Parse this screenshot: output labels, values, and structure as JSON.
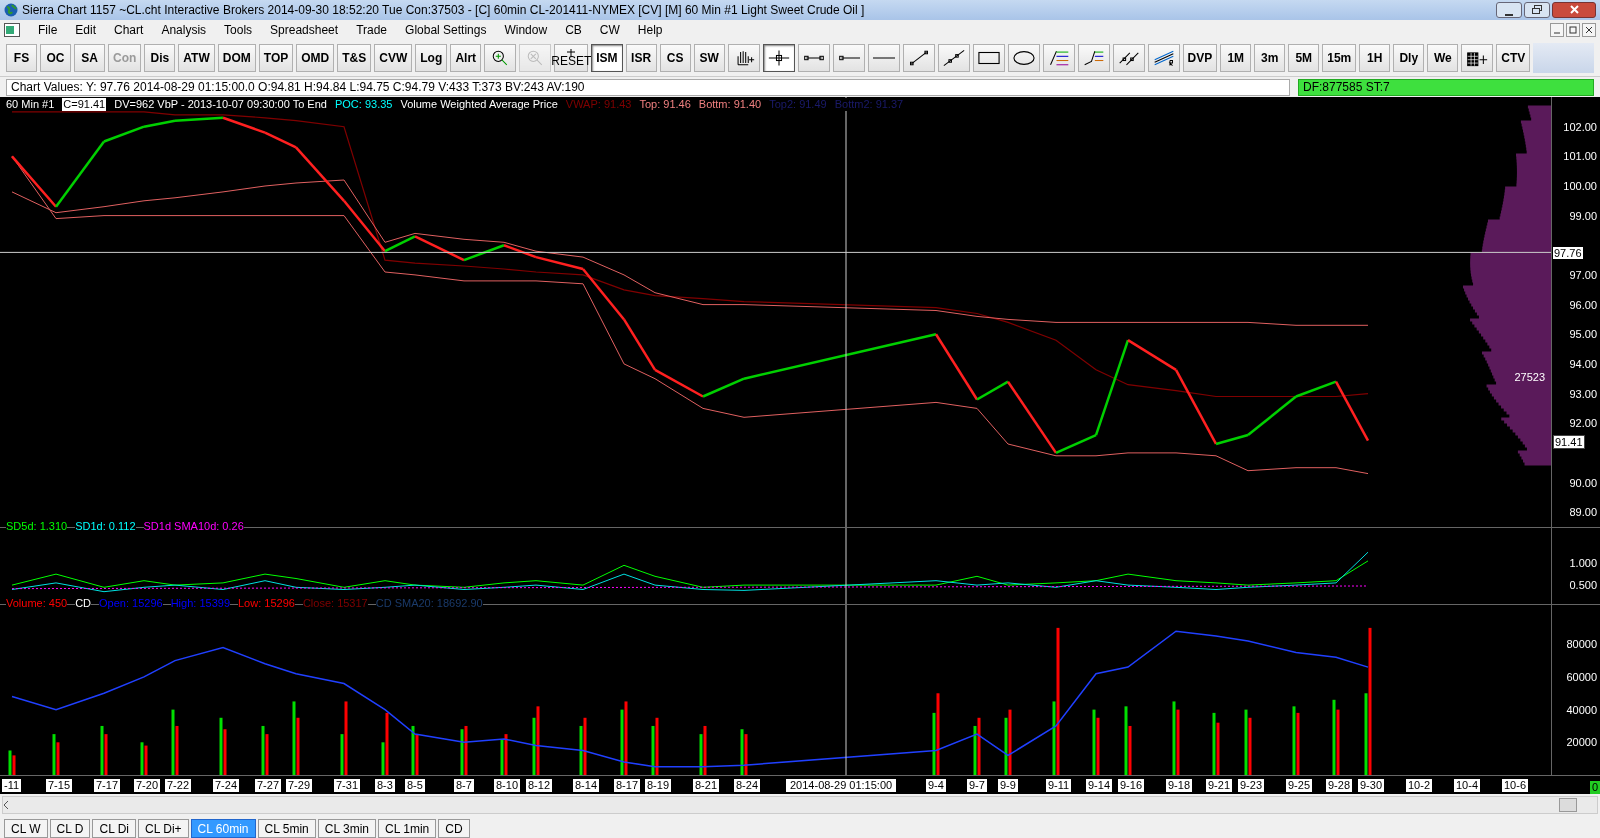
{
  "window": {
    "title": "Sierra Chart 1157 ~CL.cht  Interactive Brokers 2014-09-30  18:52:20 Tue  Con:37503 - [C] 60min  CL-201411-NYMEX [CV] [M]  60 Min  #1  Light Sweet Crude Oil ]"
  },
  "menu": [
    "File",
    "Edit",
    "Chart",
    "Analysis",
    "Tools",
    "Spreadsheet",
    "Trade",
    "Global Settings",
    "Window",
    "CB",
    "CW",
    "Help"
  ],
  "toolbar": [
    {
      "kind": "text",
      "label": "FS",
      "disabled": false,
      "selected": false
    },
    {
      "kind": "text",
      "label": "OC",
      "disabled": false,
      "selected": false
    },
    {
      "kind": "text",
      "label": "SA",
      "disabled": false,
      "selected": false
    },
    {
      "kind": "text",
      "label": "Con",
      "disabled": true,
      "selected": false
    },
    {
      "kind": "text",
      "label": "Dis",
      "disabled": false,
      "selected": false
    },
    {
      "kind": "text",
      "label": "ATW",
      "disabled": false,
      "selected": false
    },
    {
      "kind": "text",
      "label": "DOM",
      "disabled": false,
      "selected": false
    },
    {
      "kind": "text",
      "label": "TOP",
      "disabled": false,
      "selected": false
    },
    {
      "kind": "text",
      "label": "OMD",
      "disabled": false,
      "selected": false
    },
    {
      "kind": "text",
      "label": "T&S",
      "disabled": false,
      "selected": false
    },
    {
      "kind": "text",
      "label": "CVW",
      "disabled": false,
      "selected": false
    },
    {
      "kind": "text",
      "label": "Log",
      "disabled": false,
      "selected": false
    },
    {
      "kind": "text",
      "label": "Alrt",
      "disabled": false,
      "selected": false
    },
    {
      "kind": "zoom",
      "disabled": false,
      "selected": false
    },
    {
      "kind": "zoomx",
      "disabled": true,
      "selected": false
    },
    {
      "kind": "reset",
      "label": "RESET",
      "disabled": false,
      "selected": false
    },
    {
      "kind": "text",
      "label": "ISM",
      "disabled": false,
      "selected": true
    },
    {
      "kind": "text",
      "label": "ISR",
      "disabled": false,
      "selected": false
    },
    {
      "kind": "text",
      "label": "CS",
      "disabled": false,
      "selected": false
    },
    {
      "kind": "text",
      "label": "SW",
      "disabled": false,
      "selected": false
    },
    {
      "kind": "hand",
      "disabled": false,
      "selected": false
    },
    {
      "kind": "crosshair",
      "disabled": false,
      "selected": true
    },
    {
      "kind": "segment",
      "disabled": false,
      "selected": false
    },
    {
      "kind": "ray",
      "disabled": false,
      "selected": false
    },
    {
      "kind": "hline",
      "disabled": false,
      "selected": false
    },
    {
      "kind": "line",
      "disabled": false,
      "selected": false
    },
    {
      "kind": "extline",
      "disabled": false,
      "selected": false
    },
    {
      "kind": "rect",
      "disabled": false,
      "selected": false
    },
    {
      "kind": "ellipse",
      "disabled": false,
      "selected": false
    },
    {
      "kind": "fib",
      "disabled": false,
      "selected": false
    },
    {
      "kind": "fibext",
      "disabled": false,
      "selected": false
    },
    {
      "kind": "parallel",
      "disabled": false,
      "selected": false
    },
    {
      "kind": "regression",
      "disabled": false,
      "selected": false
    },
    {
      "kind": "text",
      "label": "DVP",
      "disabled": false,
      "selected": false
    },
    {
      "kind": "text",
      "label": "1M",
      "disabled": false,
      "selected": false
    },
    {
      "kind": "text",
      "label": "3m",
      "disabled": false,
      "selected": false
    },
    {
      "kind": "text",
      "label": "5M",
      "disabled": false,
      "selected": false
    },
    {
      "kind": "text",
      "label": "15m",
      "disabled": false,
      "selected": false
    },
    {
      "kind": "text",
      "label": "1H",
      "disabled": false,
      "selected": false
    },
    {
      "kind": "text",
      "label": "Dly",
      "disabled": false,
      "selected": false
    },
    {
      "kind": "text",
      "label": "We",
      "disabled": false,
      "selected": false
    },
    {
      "kind": "grid",
      "disabled": false,
      "selected": false
    },
    {
      "kind": "text",
      "label": "CTV",
      "disabled": false,
      "selected": false
    }
  ],
  "chart_values": "Chart Values: Y: 97.76  2014-08-29  01:15:00.0  O:94.81  H:94.84  L:94.75  C:94.79  V:433  T:373  BV:243  AV:190",
  "status_badge": "DF:877585  ST:7",
  "price_panel": {
    "header": [
      {
        "text": "60 Min  #1",
        "boxed": false
      },
      {
        "text": "C=91.41",
        "color": "#000000",
        "boxed": true
      },
      {
        "text": "DV=962  VbP - 2013-10-07  09:30:00 To End",
        "boxed": false
      },
      {
        "text": "POC: 93.35",
        "color": "#00ffff",
        "boxed": false
      },
      {
        "text": "Volume Weighted Average Price",
        "boxed": false
      },
      {
        "text": "VWAP: 91.43",
        "color": "#800000",
        "boxed": false
      },
      {
        "text": "Top: 91.46",
        "color": "#f08080",
        "boxed": false
      },
      {
        "text": "Bottm: 91.40",
        "color": "#f08080",
        "boxed": false
      },
      {
        "text": "Top2: 91.49",
        "color": "#1a1a6a",
        "boxed": false
      },
      {
        "text": "Bottm2: 91.37",
        "color": "#1a1a6a",
        "boxed": false
      }
    ],
    "profile_label": "27523",
    "axis_labels": [
      "102.00",
      "101.00",
      "100.00",
      "99.00",
      "97.00",
      "96.00",
      "95.00",
      "94.00",
      "93.00",
      "92.00",
      "90.00",
      "89.00"
    ],
    "markers": [
      {
        "kind": "cursor",
        "text": "97.76"
      },
      {
        "kind": "last",
        "text": "91.41"
      }
    ]
  },
  "study_panel": {
    "header": [
      {
        "text": "SD5d: 1.310",
        "color": "#00ff00"
      },
      {
        "text": "SD1d: 0.112",
        "color": "#00ffff"
      },
      {
        "text": "SD1d SMA10d: 0.26",
        "color": "#ff00ff"
      }
    ],
    "axis_labels": [
      "1.000",
      "0.500"
    ]
  },
  "volume_panel": {
    "header": [
      {
        "text": "Volume: 450",
        "color": "#ff0000"
      },
      {
        "text": "CD"
      },
      {
        "text": "Open: 15296",
        "color": "#0000ff"
      },
      {
        "text": "High: 15399",
        "color": "#0000ff"
      },
      {
        "text": "Low: 15296",
        "color": "#ff0000"
      },
      {
        "text": "Close: 15317",
        "color": "#800000"
      },
      {
        "text": "CD SMA20: 18692.90",
        "color": "#1a3a6a"
      }
    ],
    "axis_labels": [
      "80000",
      "60000",
      "40000",
      "20000"
    ]
  },
  "time_axis": {
    "labels": [
      "-11",
      "7-15",
      "7-17",
      "7-20",
      "7-22",
      "7-24",
      "7-27",
      "7-29",
      "7-31",
      "8-3",
      "8-5",
      "8-7",
      "8-10",
      "8-12",
      "8-14",
      "8-17",
      "8-19",
      "8-21",
      "8-24",
      "9-4",
      "9-7",
      "9-9",
      "9-11",
      "9-14",
      "9-16",
      "9-18",
      "9-21",
      "9-23",
      "9-25",
      "9-28",
      "9-30",
      "10-2",
      "10-4",
      "10-6"
    ],
    "cursor_label": "2014-08-29  01:15:00",
    "corner": "0"
  },
  "chart_tabs": [
    {
      "label": "CL W",
      "selected": false
    },
    {
      "label": "CL D",
      "selected": false
    },
    {
      "label": "CL Di",
      "selected": false
    },
    {
      "label": "CL Di+",
      "selected": false
    },
    {
      "label": "CL 60min",
      "selected": true
    },
    {
      "label": "CL 5min",
      "selected": false
    },
    {
      "label": "CL 3min",
      "selected": false
    },
    {
      "label": "CL 1min",
      "selected": false
    },
    {
      "label": "CD",
      "selected": false
    }
  ]
}
